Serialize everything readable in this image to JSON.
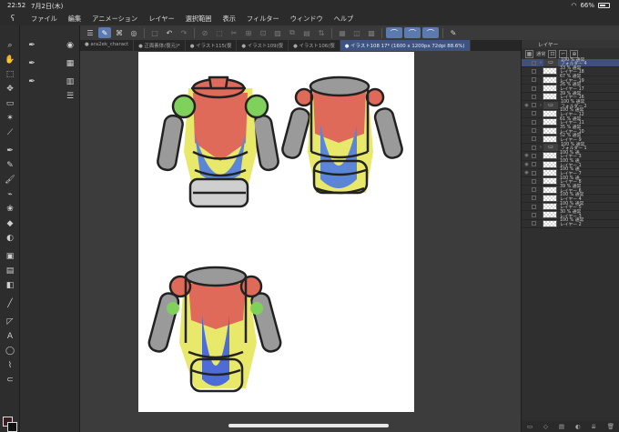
{
  "status": {
    "time": "22:52",
    "date": "7月2日(木)",
    "battery": "66%"
  },
  "menu": {
    "logo": "ʕ",
    "items": [
      "ファイル",
      "編集",
      "アニメーション",
      "レイヤー",
      "選択範囲",
      "表示",
      "フィルター",
      "ウィンドウ",
      "ヘルプ"
    ]
  },
  "tabs": [
    {
      "label": "● ara2ek_charact",
      "active": false
    },
    {
      "label": "● 正面素体(復元)*",
      "active": false
    },
    {
      "label": "● イラスト115(復",
      "active": false
    },
    {
      "label": "● イラスト109(復",
      "active": false
    },
    {
      "label": "● イラスト106(復",
      "active": false
    },
    {
      "label": "● イラスト108 17* (1600 x 1200px 72dpi 88.6%)",
      "active": true
    }
  ],
  "layers_panel": {
    "title": "レイヤー",
    "blend_mode": "通常",
    "rows": [
      {
        "top": "100 % 通常",
        "bottom": "フォルダー 4",
        "type": "folder",
        "selected": true
      },
      {
        "top": "33 % 通常",
        "bottom": "レイヤー 18",
        "type": "layer"
      },
      {
        "top": "67 % 通常",
        "bottom": "レイヤー 19",
        "type": "layer"
      },
      {
        "top": "26 % 通常",
        "bottom": "レイヤー 17",
        "type": "layer"
      },
      {
        "top": "39 % 通常",
        "bottom": "レイヤー 16",
        "type": "layer"
      },
      {
        "top": "100 % 通常",
        "bottom": "フォルダー 2",
        "type": "folder"
      },
      {
        "top": "100 % 通常",
        "bottom": "レイヤー 12",
        "type": "layer"
      },
      {
        "top": "61 % 通常",
        "bottom": "レイヤー 11",
        "type": "layer"
      },
      {
        "top": "35 % 通常",
        "bottom": "レイヤー 10",
        "type": "layer"
      },
      {
        "top": "52 % 通常",
        "bottom": "レイヤー 9",
        "type": "layer"
      },
      {
        "top": "100 % 通常",
        "bottom": "フォルダー 1",
        "type": "folder"
      },
      {
        "top": "100 % 通",
        "bottom": "レイヤー 3",
        "type": "layer"
      },
      {
        "top": "100 % 通",
        "bottom": "レイヤー 1",
        "type": "layer"
      },
      {
        "top": "100 % 通",
        "bottom": "レイヤー 7",
        "type": "layer"
      },
      {
        "top": "100 % 通",
        "bottom": "レイヤー 8",
        "type": "layer"
      },
      {
        "top": "39 % 通常",
        "bottom": "レイヤー 6",
        "type": "layer"
      },
      {
        "top": "100 % 通常",
        "bottom": "レイヤー 4",
        "type": "layer"
      },
      {
        "top": "100 % 通常",
        "bottom": "レイヤー 5",
        "type": "layer"
      },
      {
        "top": "30 % 通常",
        "bottom": "レイヤー 3",
        "type": "layer"
      },
      {
        "top": "100 % 通常",
        "bottom": "レイヤー 2",
        "type": "layer"
      }
    ]
  },
  "colors": {
    "main": "#3a1e24",
    "sub": "#111111",
    "accent": "#5a7ab0"
  }
}
